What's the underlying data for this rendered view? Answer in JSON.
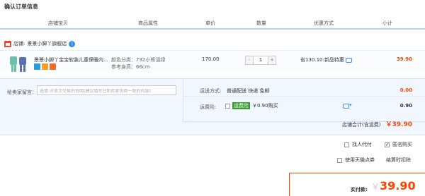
{
  "page": {
    "title": "确认订单信息"
  },
  "columns": [
    "店铺宝贝",
    "商品属性",
    "单价",
    "数量",
    "优惠方式",
    "小计"
  ],
  "shop": {
    "name_prefix": "店铺:",
    "name": "景景小脚丫旗舰店",
    "badge": "i"
  },
  "item": {
    "name": "景景小脚丫宝宝软装儿童保暖内...",
    "attr_color": "颜色分类：732小熊浸绿",
    "attr_size": "参考身高：66cm",
    "price": "170.00",
    "quantity": "1",
    "minus": "-",
    "plus": "+",
    "discount": "省130.10:新品特惠",
    "subtotal": "39.90"
  },
  "message": {
    "label": "给卖家留言：",
    "placeholder": "选填:对本次交易的说明(建议填写已和卖家协商一致的内容)"
  },
  "shipping": {
    "label": "运送方式:",
    "value": "普通配送 快递 免邮",
    "price": "0.00",
    "insurance_label": "运费险:",
    "insurance_tag": "运费险",
    "insurance_value": "￥0.90购买",
    "insurance_price": "0.90"
  },
  "shop_total": {
    "label": "店铺合计(含运费)",
    "value": "￥39.90"
  },
  "options": {
    "proxy_pay": "找人代付",
    "anonymous": "匿名购买",
    "tmall_points": "使用天猫点券",
    "settle_deduct": "结算时扣除"
  },
  "final": {
    "label": "实付款:",
    "currency": "￥",
    "value": "39.90"
  },
  "colors": {
    "accent": "#ff4400",
    "header_border": "#b2d1ff",
    "panel_bg": "#f2f7ff"
  }
}
